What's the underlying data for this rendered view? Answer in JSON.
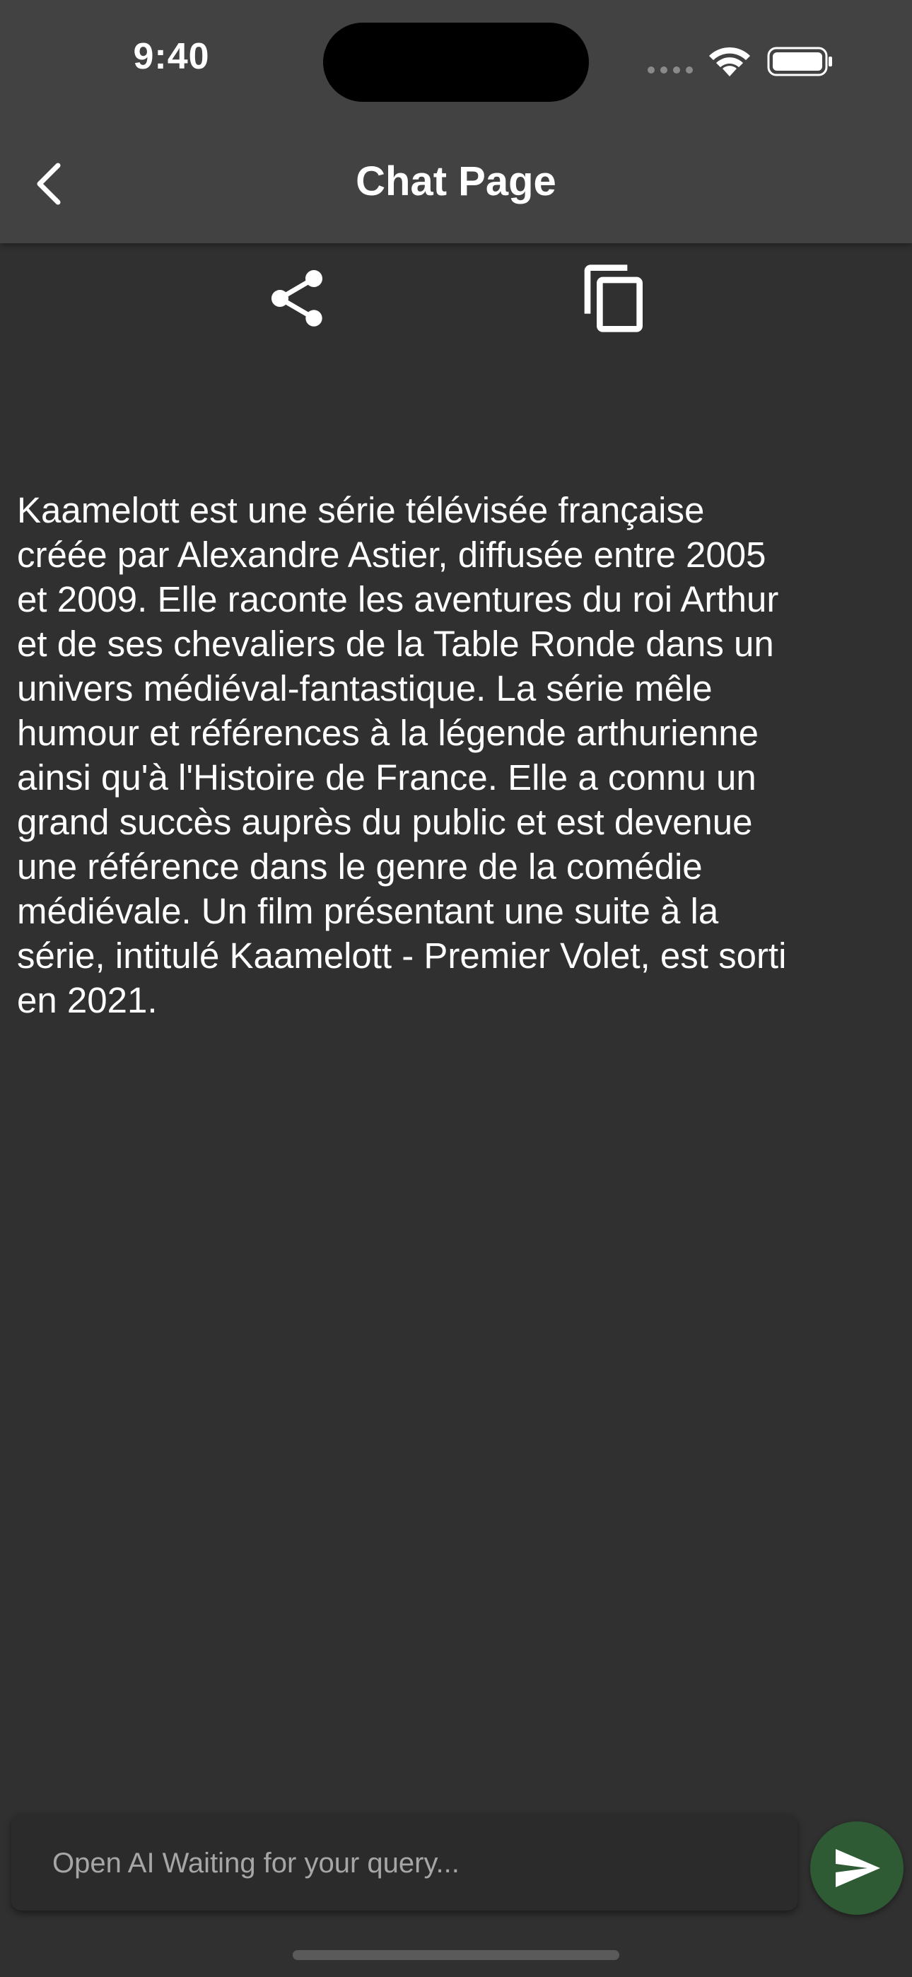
{
  "status_bar": {
    "time": "9:40"
  },
  "header": {
    "title": "Chat Page",
    "back_icon": "chevron-left-icon"
  },
  "actions": {
    "share_icon": "share-icon",
    "copy_icon": "copy-icon"
  },
  "chat": {
    "response": "Kaamelott est une série télévisée française\ncréée par Alexandre Astier, diffusée entre 2005\net 2009. Elle raconte les aventures du roi Arthur\net de ses chevaliers de la Table Ronde dans un\nunivers médiéval-fantastique. La série mêle\nhumour et références à la légende arthurienne\nainsi qu'à l'Histoire de France. Elle a connu un\ngrand succès auprès du public et est devenue\nune référence dans le genre de la comédie\nmédiévale. Un film présentant une suite à la\nsérie, intitulé Kaamelott - Premier Volet, est sorti\nen 2021."
  },
  "input": {
    "placeholder": "Open AI Waiting for your query...",
    "value": "",
    "send_icon": "send-icon"
  },
  "colors": {
    "background": "#303030",
    "header": "#424242",
    "send_button": "#2f5b34"
  }
}
